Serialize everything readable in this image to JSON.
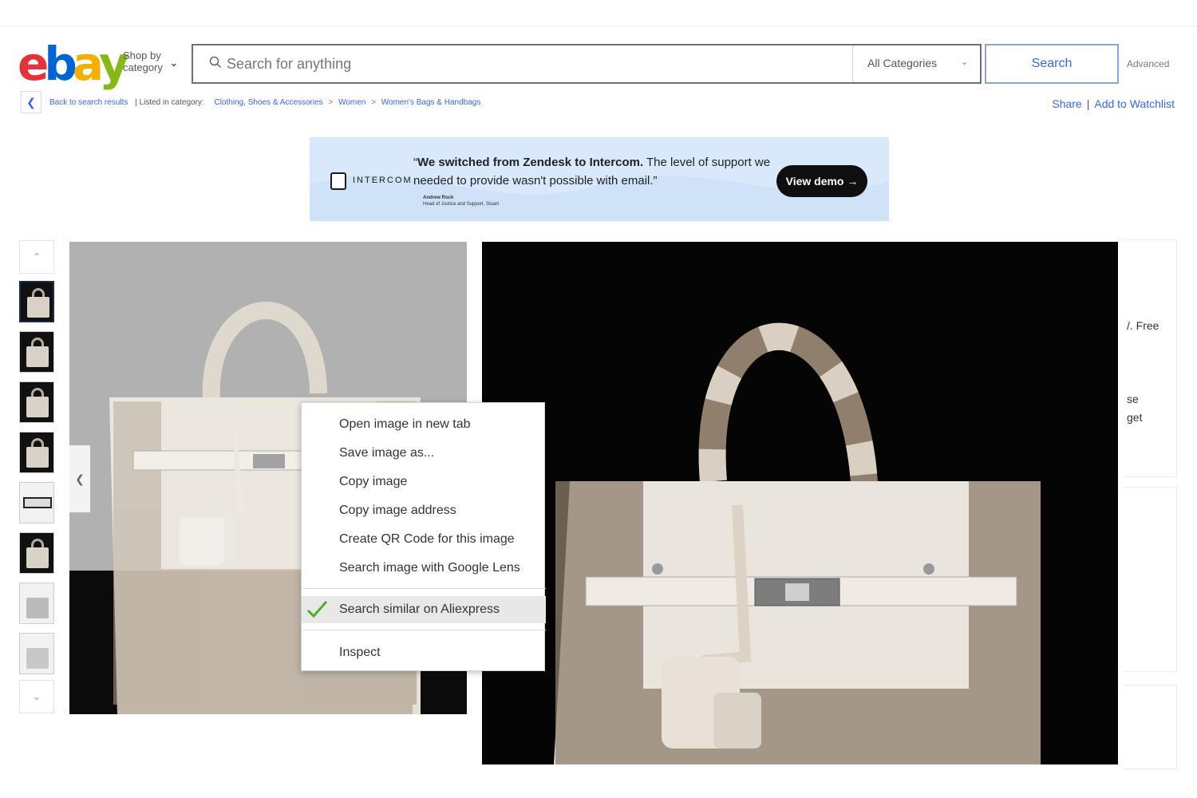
{
  "header": {
    "logo_letters": [
      "e",
      "b",
      "a",
      "y"
    ],
    "logo_colors": [
      "#e53238",
      "#0064d2",
      "#f5af02",
      "#86b817"
    ],
    "shop_by_label": "Shop by category",
    "search_placeholder": "Search for anything",
    "category_select": "All Categories",
    "search_button": "Search",
    "advanced_link": "Advanced"
  },
  "breadcrumb": {
    "back_label": "Back to search results",
    "listed_in": "| Listed in category:",
    "items": [
      "Clothing, Shoes & Accessories",
      "Women",
      "Women's Bags & Handbags"
    ],
    "separator": ">",
    "share": "Share",
    "divider": "|",
    "watchlist": "Add to Watchlist"
  },
  "ad": {
    "brand": "INTERCOM",
    "quote_bold": "We switched from Zendesk to Intercom.",
    "quote_rest": " The level of support we needed to provide wasn't possible with email.",
    "open_quote": "“",
    "close_quote": "”",
    "author_name": "Andrew Rock",
    "author_title": "Head of Justice and Support, Stuart",
    "cta": "View demo →"
  },
  "gallery": {
    "thumbnails_count": 8,
    "up_icon": "chevron-up-icon",
    "down_icon": "chevron-down-icon"
  },
  "side_cards": {
    "text_1": "/. Free",
    "text_2": "se",
    "text_3": "get"
  },
  "context_menu": {
    "items": [
      "Open image in new tab",
      "Save image as...",
      "Copy image",
      "Copy image address",
      "Create QR Code for this image",
      "Search image with Google Lens"
    ],
    "highlighted_item": "Search similar on Aliexpress",
    "last_item": "Inspect",
    "check_color": "#4caf2a"
  },
  "colors": {
    "link": "#3665f3",
    "ad_background": "#d9e9fb"
  }
}
